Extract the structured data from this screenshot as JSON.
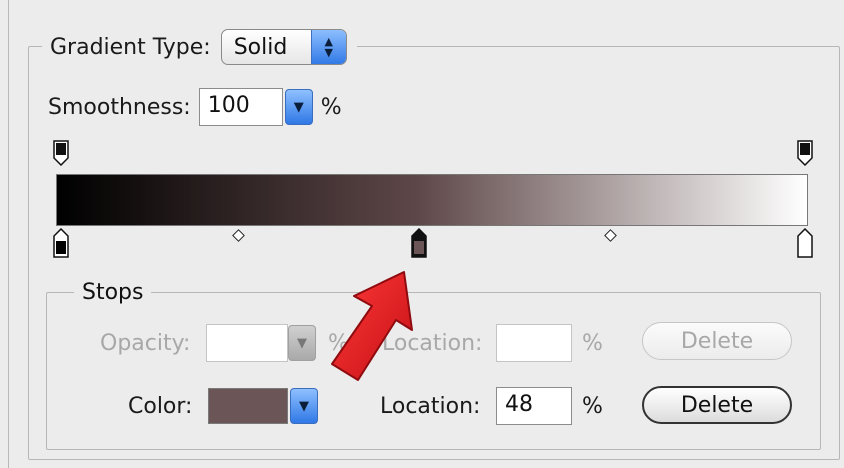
{
  "gradient_type": {
    "label": "Gradient Type:",
    "value": "Solid"
  },
  "smoothness": {
    "label": "Smoothness:",
    "value": "100",
    "unit": "%"
  },
  "gradient": {
    "start_color": "#000000",
    "mid_color": "#5e4748",
    "end_color": "#ffffff"
  },
  "stops": {
    "legend": "Stops",
    "opacity": {
      "label": "Opacity:",
      "value": "",
      "unit": "%",
      "location_label": "Location:",
      "location_value": "",
      "location_unit": "%",
      "delete_label": "Delete"
    },
    "color": {
      "label": "Color:",
      "swatch_color": "#6b5556",
      "location_label": "Location:",
      "location_value": "48",
      "location_unit": "%",
      "delete_label": "Delete"
    }
  },
  "annotation": {
    "arrow_color": "#e8141b",
    "arrow_icon": "red-pointer-arrow-icon"
  }
}
